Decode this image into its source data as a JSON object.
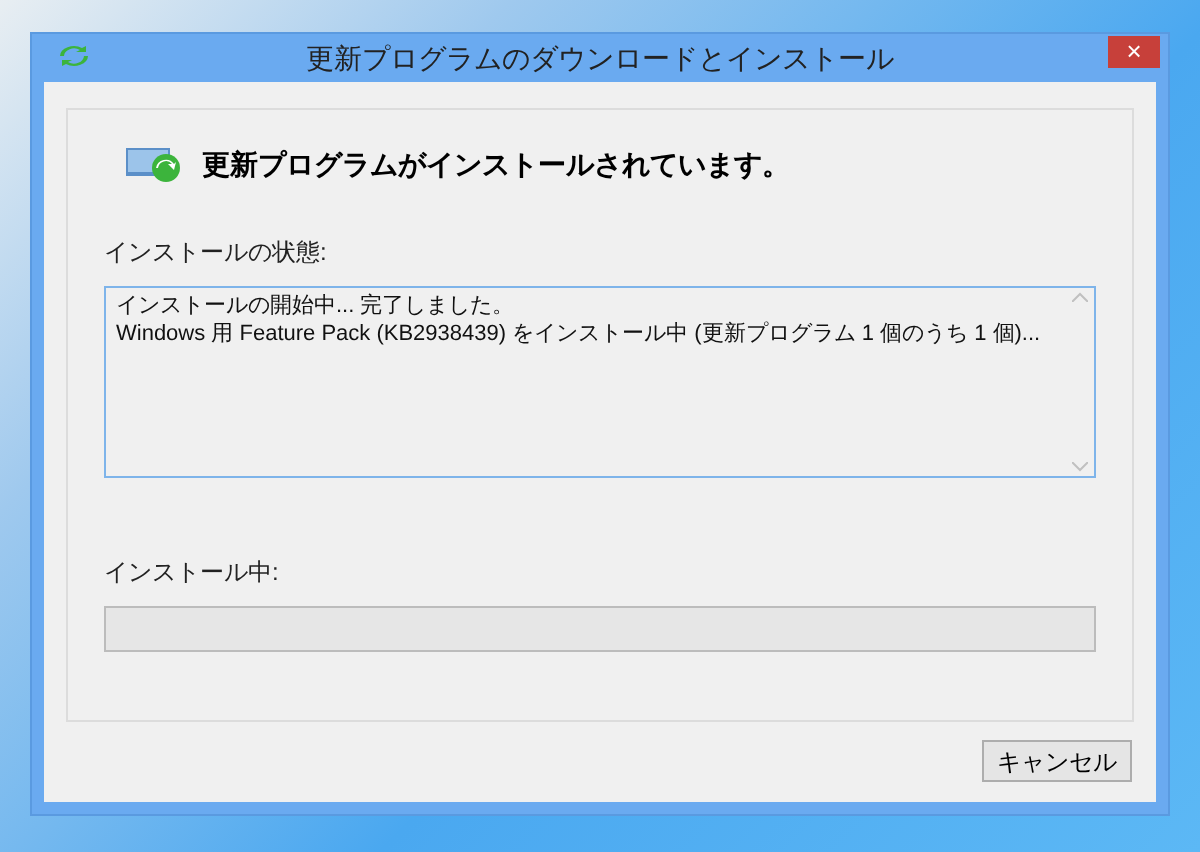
{
  "window": {
    "title": "更新プログラムのダウンロードとインストール",
    "close": "×"
  },
  "heading": "更新プログラムがインストールされています。",
  "status": {
    "label": "インストールの状態:",
    "lines": [
      "インストールの開始中... 完了しました。",
      "Windows 用 Feature Pack (KB2938439) をインストール中 (更新プログラム 1 個のうち 1 個)..."
    ]
  },
  "progress": {
    "label": "インストール中:",
    "level": 0
  },
  "buttons": [
    "キャンセル"
  ]
}
